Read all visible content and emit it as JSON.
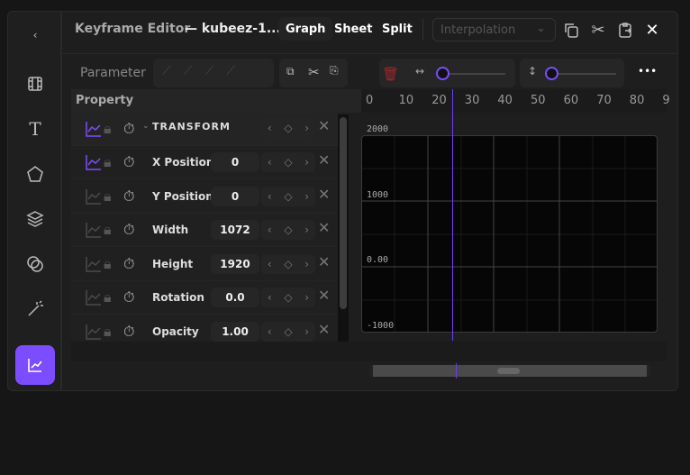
{
  "sidebar": {
    "items": [
      {
        "name": "back"
      },
      {
        "name": "film"
      },
      {
        "name": "text"
      },
      {
        "name": "shape"
      },
      {
        "name": "layers"
      },
      {
        "name": "blend"
      },
      {
        "name": "magic"
      },
      {
        "name": "graph",
        "active": true
      }
    ]
  },
  "header": {
    "title": "Keyframe Editor",
    "file": "— kubeez-1...",
    "tabs": [
      "Graph",
      "Sheet",
      "Split"
    ],
    "selected_tab": "Graph",
    "interpolation_placeholder": "Interpolation"
  },
  "toolbar": {
    "parameter_label": "Parameter",
    "more": "•••",
    "h_zoom": 0.0,
    "v_zoom": 0.0
  },
  "properties": {
    "header": "Property",
    "group": "TRANSFORM",
    "rows": [
      {
        "label": "X Position",
        "value": "0",
        "graph_on": true
      },
      {
        "label": "Y Position",
        "value": "0",
        "graph_on": false
      },
      {
        "label": "Width",
        "value": "1072",
        "graph_on": false
      },
      {
        "label": "Height",
        "value": "1920",
        "graph_on": false
      },
      {
        "label": "Rotation",
        "value": "0.0",
        "graph_on": false
      },
      {
        "label": "Opacity",
        "value": "1.00",
        "graph_on": false
      }
    ]
  },
  "timeline": {
    "ticks": [
      "0",
      "10",
      "20",
      "30",
      "40",
      "50",
      "60",
      "70",
      "80",
      "9"
    ],
    "playhead_frame": 25
  },
  "graph": {
    "y_labels": [
      "2000",
      "1000",
      "0.00",
      "-1000"
    ]
  },
  "colors": {
    "accent": "#7c4dff",
    "delete": "#a3262a"
  }
}
